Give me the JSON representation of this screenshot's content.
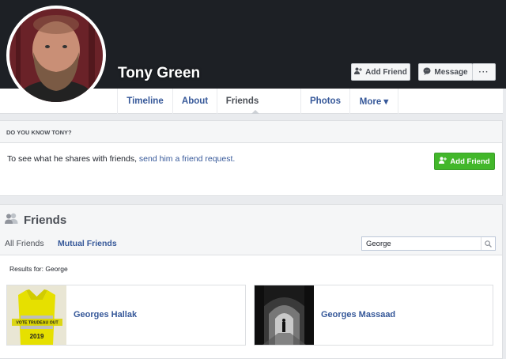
{
  "profile": {
    "name": "Tony Green",
    "add_friend_label": "Add Friend",
    "message_label": "Message",
    "more_label": "···"
  },
  "nav": {
    "tabs": [
      {
        "label": "Timeline"
      },
      {
        "label": "About"
      },
      {
        "label": "Friends"
      },
      {
        "label": "Photos"
      },
      {
        "label": "More ▾"
      }
    ]
  },
  "know": {
    "heading": "DO YOU KNOW TONY?",
    "text_prefix": "To see what he shares with friends, ",
    "link_text": "send him a friend request.",
    "button_label": "Add Friend"
  },
  "friends": {
    "title": "Friends",
    "tab_all": "All Friends",
    "tab_mutual": "Mutual Friends",
    "search_value": "George",
    "results_label": "Results for: George",
    "results": [
      {
        "name": "Georges Hallak",
        "thumb_text_1": "VOTE TRUDEAU OUT",
        "thumb_text_2": "2019"
      },
      {
        "name": "Georges Massaad"
      }
    ]
  },
  "colors": {
    "link": "#365899",
    "green_button": "#42b72a",
    "cover": "#1d2025"
  },
  "icons": [
    "add-friend-icon",
    "messenger-icon",
    "friends-icon",
    "search-icon"
  ]
}
